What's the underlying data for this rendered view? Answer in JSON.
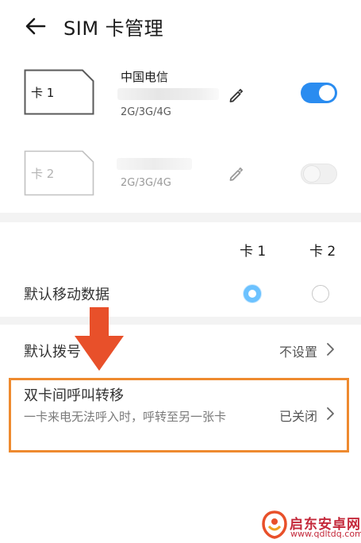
{
  "header": {
    "title": "SIM 卡管理"
  },
  "sim_cards": [
    {
      "label": "卡 1",
      "carrier": "中国电信",
      "network": "2G/3G/4G",
      "enabled": true
    },
    {
      "label": "卡 2",
      "carrier": "",
      "network": "2G/3G/4G",
      "enabled": false
    }
  ],
  "default_data": {
    "label": "默认移动数据",
    "columns": [
      "卡 1",
      "卡 2"
    ],
    "selected": "卡 1"
  },
  "default_dial": {
    "label": "默认拨号",
    "value": "不设置"
  },
  "call_forward": {
    "title": "双卡间呼叫转移",
    "description": "一卡来电无法呼入时，呼转至另一张卡",
    "value": "已关闭"
  },
  "watermark": {
    "name": "启东安卓网",
    "url": "www.qdltdq.com"
  },
  "colors": {
    "accent": "#2a8cf0",
    "highlight": "#ee8a2f",
    "arrow": "#e8502a",
    "watermark": "#c4283a"
  },
  "icons": {
    "back": "arrow-left-icon",
    "edit": "pencil-icon",
    "chevron": "chevron-right-icon",
    "annotation": "arrow-down-icon"
  }
}
